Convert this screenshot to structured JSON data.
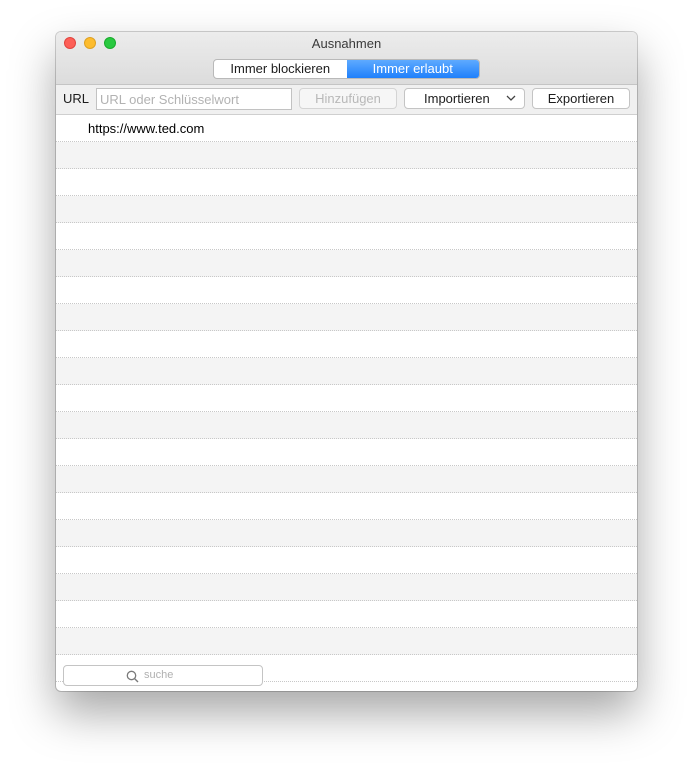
{
  "window": {
    "title": "Ausnahmen"
  },
  "segments": [
    {
      "label": "Immer blockieren",
      "active": false
    },
    {
      "label": "Immer erlaubt",
      "active": true
    }
  ],
  "toolbar": {
    "url_label": "URL",
    "url_placeholder": "URL oder Schlüsselwort",
    "url_value": "",
    "add_label": "Hinzufügen",
    "import_label": "Importieren",
    "export_label": "Exportieren"
  },
  "list": {
    "entries": [
      "https://www.ted.com"
    ]
  },
  "search": {
    "placeholder": "suche"
  },
  "colors": {
    "accent": "#1f80fb",
    "close": "#fd5f57",
    "minimize": "#fdbc2e",
    "zoom": "#29c940"
  }
}
